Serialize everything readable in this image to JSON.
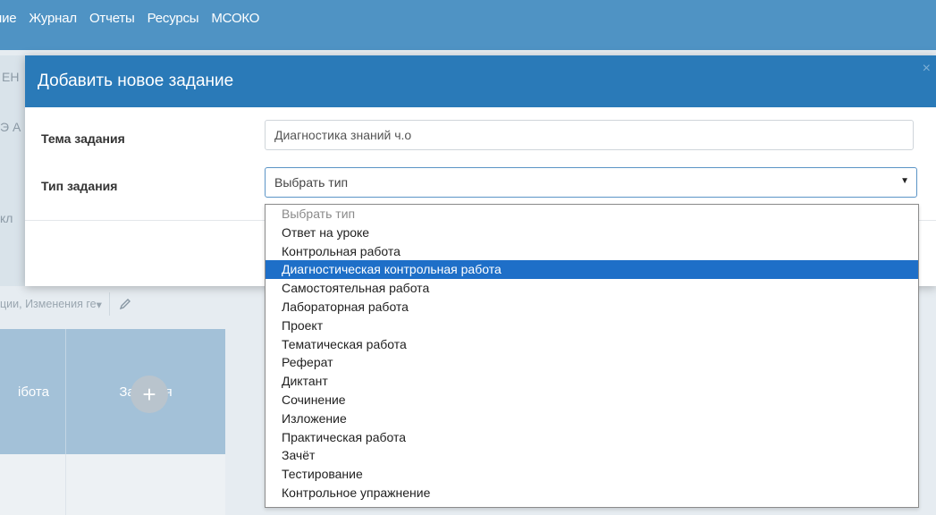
{
  "nav": {
    "items": [
      {
        "label": "ние"
      },
      {
        "label": "Журнал"
      },
      {
        "label": "Отчеты"
      },
      {
        "label": "Ресурсы"
      },
      {
        "label": "МСОКО"
      }
    ]
  },
  "background": {
    "left_fragments": [
      "ЕН",
      "Э А",
      "кл"
    ],
    "filter_text": "ции, Изменения ге",
    "filter_caret": "▾",
    "table": {
      "headers": [
        "ібота",
        "Задания"
      ],
      "plus": "+"
    }
  },
  "modal": {
    "title": "Добавить новое задание",
    "close": "×",
    "topic_label": "Тема задания",
    "topic_value": "Диагностика знаний ч.о",
    "type_label": "Тип задания",
    "type_selected": "Выбрать тип",
    "arrow": "▼"
  },
  "dropdown": {
    "options": [
      {
        "label": "Выбрать тип",
        "placeholder": true,
        "highlighted": false
      },
      {
        "label": "Ответ на уроке",
        "placeholder": false,
        "highlighted": false
      },
      {
        "label": "Контрольная работа",
        "placeholder": false,
        "highlighted": false
      },
      {
        "label": "Диагностическая контрольная работа",
        "placeholder": false,
        "highlighted": true
      },
      {
        "label": "Самостоятельная работа",
        "placeholder": false,
        "highlighted": false
      },
      {
        "label": "Лабораторная работа",
        "placeholder": false,
        "highlighted": false
      },
      {
        "label": "Проект",
        "placeholder": false,
        "highlighted": false
      },
      {
        "label": "Тематическая работа",
        "placeholder": false,
        "highlighted": false
      },
      {
        "label": "Реферат",
        "placeholder": false,
        "highlighted": false
      },
      {
        "label": "Диктант",
        "placeholder": false,
        "highlighted": false
      },
      {
        "label": "Сочинение",
        "placeholder": false,
        "highlighted": false
      },
      {
        "label": "Изложение",
        "placeholder": false,
        "highlighted": false
      },
      {
        "label": "Практическая работа",
        "placeholder": false,
        "highlighted": false
      },
      {
        "label": "Зачёт",
        "placeholder": false,
        "highlighted": false
      },
      {
        "label": "Тестирование",
        "placeholder": false,
        "highlighted": false
      },
      {
        "label": "Контрольное упражнение",
        "placeholder": false,
        "highlighted": false
      }
    ]
  },
  "colors": {
    "nav_bg": "#4f93c4",
    "modal_header_bg": "#2a7ab8",
    "highlight_bg": "#1e6fc8"
  }
}
